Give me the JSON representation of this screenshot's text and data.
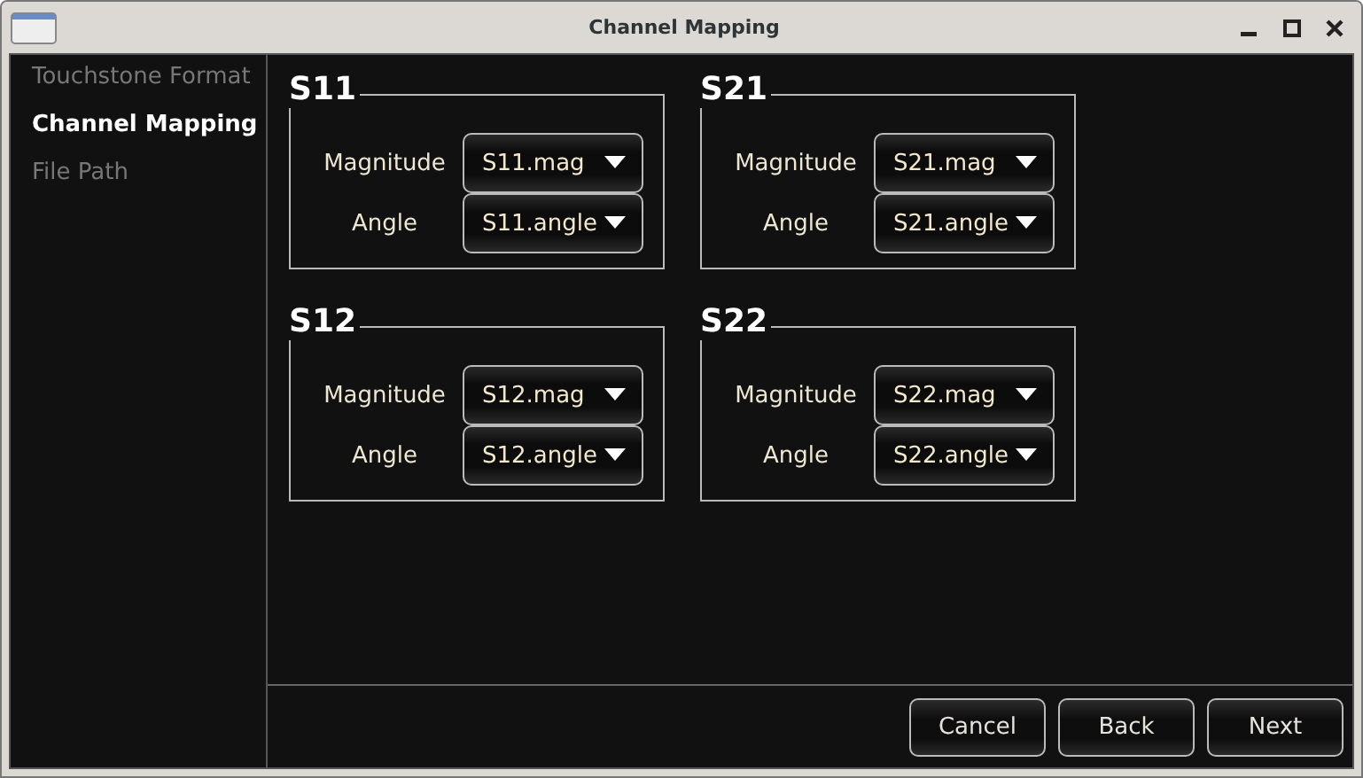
{
  "window": {
    "title": "Channel Mapping"
  },
  "sidebar": {
    "items": [
      {
        "label": "Touchstone Format",
        "selected": false
      },
      {
        "label": "Channel Mapping",
        "selected": true
      },
      {
        "label": "File Path",
        "selected": false
      }
    ]
  },
  "groups": [
    {
      "title": "S11",
      "fields": [
        {
          "label": "Magnitude",
          "value": "S11.mag"
        },
        {
          "label": "Angle",
          "value": "S11.angle"
        }
      ]
    },
    {
      "title": "S21",
      "fields": [
        {
          "label": "Magnitude",
          "value": "S21.mag"
        },
        {
          "label": "Angle",
          "value": "S21.angle"
        }
      ]
    },
    {
      "title": "S12",
      "fields": [
        {
          "label": "Magnitude",
          "value": "S12.mag"
        },
        {
          "label": "Angle",
          "value": "S12.angle"
        }
      ]
    },
    {
      "title": "S22",
      "fields": [
        {
          "label": "Magnitude",
          "value": "S22.mag"
        },
        {
          "label": "Angle",
          "value": "S22.angle"
        }
      ]
    }
  ],
  "buttons": [
    "Cancel",
    "Back",
    "Next"
  ]
}
